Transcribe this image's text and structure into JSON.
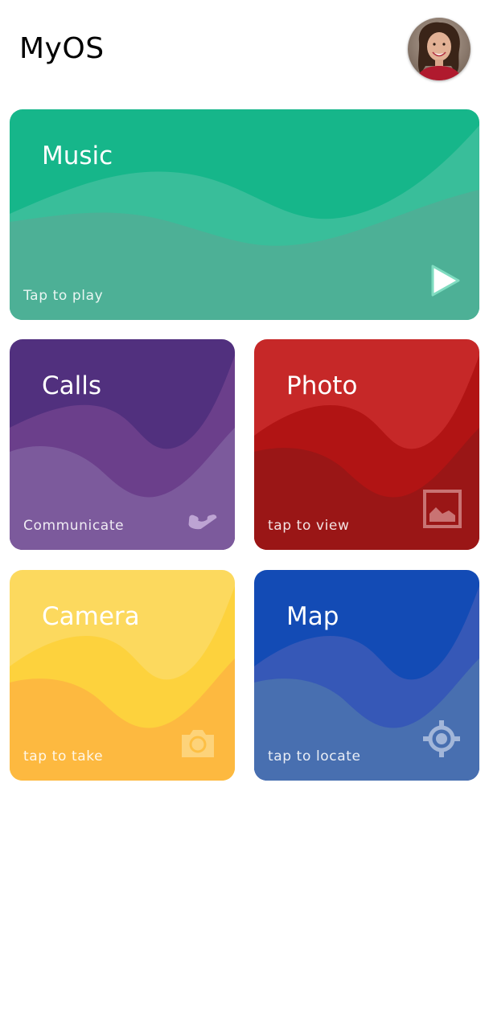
{
  "app": {
    "title": "MyOS"
  },
  "colors": {
    "music": [
      "#16b68a",
      "#39be9a",
      "#4db096"
    ],
    "calls": [
      "#51307e",
      "#6b3f8b",
      "#7c5a9c"
    ],
    "photo": [
      "#c62828",
      "#b11414",
      "#9a1616"
    ],
    "camera": [
      "#fcd95e",
      "#fdd23d",
      "#fdb940"
    ],
    "map": [
      "#134bb5",
      "#3658b7",
      "#486fb0"
    ]
  },
  "cards": {
    "music": {
      "title": "Music",
      "subtitle": "Tap to play",
      "icon": "play-icon"
    },
    "calls": {
      "title": "Calls",
      "subtitle": "Communicate",
      "icon": "phone-icon"
    },
    "photo": {
      "title": "Photo",
      "subtitle": "tap to view",
      "icon": "image-icon"
    },
    "camera": {
      "title": "Camera",
      "subtitle": "tap to take",
      "icon": "camera-icon"
    },
    "map": {
      "title": "Map",
      "subtitle": "tap to locate",
      "icon": "crosshair-icon"
    }
  }
}
